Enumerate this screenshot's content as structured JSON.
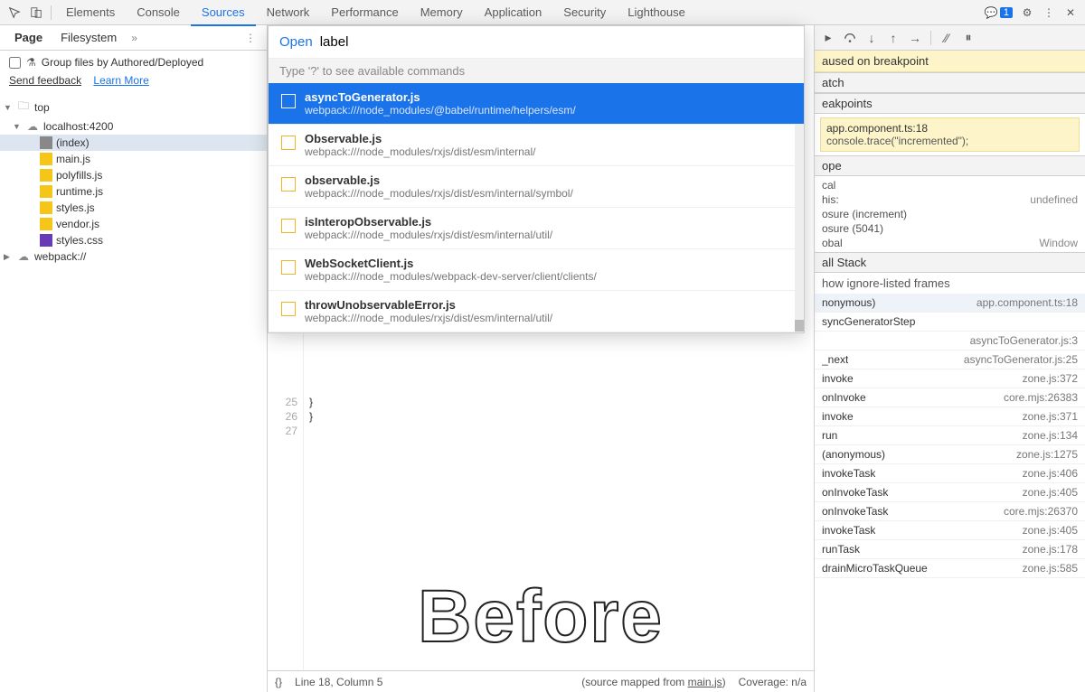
{
  "top": {
    "tabs": [
      "Elements",
      "Console",
      "Sources",
      "Network",
      "Performance",
      "Memory",
      "Application",
      "Security",
      "Lighthouse"
    ],
    "active": 2,
    "badge": "1"
  },
  "left": {
    "tabs": [
      "Page",
      "Filesystem"
    ],
    "active": 0,
    "group_label": "Group files by Authored/Deployed",
    "feedback": "Send feedback",
    "learn": "Learn More",
    "tree": [
      {
        "type": "folder",
        "label": "top",
        "indent": 0,
        "open": true,
        "icon": "folder"
      },
      {
        "type": "folder",
        "label": "localhost:4200",
        "indent": 1,
        "open": true,
        "icon": "cloud"
      },
      {
        "type": "file",
        "label": "(index)",
        "indent": 2,
        "icon": "file-page",
        "selected": true
      },
      {
        "type": "file",
        "label": "main.js",
        "indent": 2,
        "icon": "file-js"
      },
      {
        "type": "file",
        "label": "polyfills.js",
        "indent": 2,
        "icon": "file-js"
      },
      {
        "type": "file",
        "label": "runtime.js",
        "indent": 2,
        "icon": "file-js"
      },
      {
        "type": "file",
        "label": "styles.js",
        "indent": 2,
        "icon": "file-js"
      },
      {
        "type": "file",
        "label": "vendor.js",
        "indent": 2,
        "icon": "file-js"
      },
      {
        "type": "file",
        "label": "styles.css",
        "indent": 2,
        "icon": "file-css"
      },
      {
        "type": "folder",
        "label": "webpack://",
        "indent": 0,
        "open": false,
        "icon": "cloud"
      }
    ]
  },
  "popup": {
    "command": "Open",
    "query": "label",
    "hint": "Type '?' to see available commands",
    "items": [
      {
        "title": "asyncToGenerator.js",
        "path": "webpack:///node_modules/@babel/runtime/helpers/esm/",
        "sel": true
      },
      {
        "title": "Observable.js",
        "path": "webpack:///node_modules/rxjs/dist/esm/internal/"
      },
      {
        "title": "observable.js",
        "path": "webpack:///node_modules/rxjs/dist/esm/internal/symbol/"
      },
      {
        "title": "isInteropObservable.js",
        "path": "webpack:///node_modules/rxjs/dist/esm/internal/util/"
      },
      {
        "title": "WebSocketClient.js",
        "path": "webpack:///node_modules/webpack-dev-server/client/clients/"
      },
      {
        "title": "throwUnobservableError.js",
        "path": "webpack:///node_modules/rxjs/dist/esm/internal/util/"
      }
    ]
  },
  "editor": {
    "lines": [
      {
        "n": 25,
        "t": "  }"
      },
      {
        "n": 26,
        "t": "}"
      },
      {
        "n": 27,
        "t": ""
      }
    ]
  },
  "overlay": "Before",
  "status": {
    "braces": "{}",
    "pos": "Line 18, Column 5",
    "mapped_prefix": "(source mapped from ",
    "mapped_file": "main.js",
    "mapped_suffix": ")",
    "coverage": "Coverage: n/a"
  },
  "right": {
    "banner": "aused on breakpoint",
    "watch_hd": "atch",
    "bp_hd": "eakpoints",
    "bp": {
      "l1": "app.component.ts:18",
      "l2": "console.trace(\"incremented\");"
    },
    "scope_hd": "ope",
    "scope": [
      {
        "k": "cal",
        "v": ""
      },
      {
        "k": "his:",
        "v": "undefined"
      },
      {
        "k": "osure (increment)",
        "v": ""
      },
      {
        "k": "osure (5041)",
        "v": ""
      },
      {
        "k": "obal",
        "v": "Window"
      }
    ],
    "stack_hd": "all Stack",
    "ignore": "how ignore-listed frames",
    "stack": [
      {
        "fn": "nonymous)",
        "loc": "app.component.ts:18",
        "active": true
      },
      {
        "fn": "syncGeneratorStep",
        "loc": ""
      },
      {
        "fn": "",
        "loc": "asyncToGenerator.js:3"
      },
      {
        "fn": "_next",
        "loc": "asyncToGenerator.js:25"
      },
      {
        "fn": "invoke",
        "loc": "zone.js:372"
      },
      {
        "fn": "onInvoke",
        "loc": "core.mjs:26383"
      },
      {
        "fn": "invoke",
        "loc": "zone.js:371"
      },
      {
        "fn": "run",
        "loc": "zone.js:134"
      },
      {
        "fn": "(anonymous)",
        "loc": "zone.js:1275"
      },
      {
        "fn": "invokeTask",
        "loc": "zone.js:406"
      },
      {
        "fn": "onInvokeTask",
        "loc": "zone.js:405"
      },
      {
        "fn": "onInvokeTask",
        "loc": "core.mjs:26370"
      },
      {
        "fn": "invokeTask",
        "loc": "zone.js:405"
      },
      {
        "fn": "runTask",
        "loc": "zone.js:178"
      },
      {
        "fn": "drainMicroTaskQueue",
        "loc": "zone.js:585"
      }
    ]
  }
}
